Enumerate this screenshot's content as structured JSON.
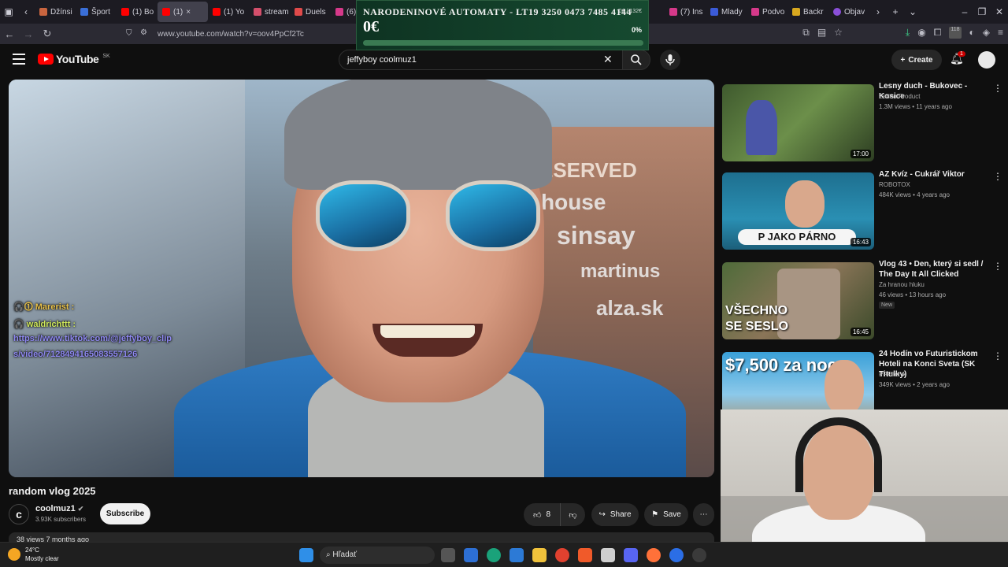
{
  "browser": {
    "tabs": [
      {
        "label": "Džínsi",
        "color": "#c9653f"
      },
      {
        "label": "Šport",
        "color": "#3a6fd8"
      },
      {
        "label": "(1) Bo",
        "color": "#ff0000"
      },
      {
        "label": "(1)",
        "color": "#ff0000"
      },
      {
        "label": "(1) Yo",
        "color": "#ff0000"
      },
      {
        "label": "stream",
        "color": "#d44f6b"
      },
      {
        "label": "Duels",
        "color": "#e04a4a"
      },
      {
        "label": "(6)",
        "color": "#d6398a"
      },
      {
        "label": "(7) Ins",
        "color": "#d6398a"
      },
      {
        "label": "Mlady",
        "color": "#3b5bd8"
      },
      {
        "label": "Podvo",
        "color": "#d6398a"
      },
      {
        "label": "Backr",
        "color": "#d8a81f"
      },
      {
        "label": "Objav",
        "color": "#8a4fd8"
      }
    ],
    "url": "www.youtube.com/watch?v=oov4PpCf2Tc",
    "download_badge": "118"
  },
  "donation": {
    "title": "NARODENINOVÉ AUTOMATY - LT19 3250 0473 7485 4144",
    "goal": "0€ / 132€",
    "amount": "0€",
    "percent": "0%",
    "progress": 0
  },
  "youtube": {
    "logo": "YouTube",
    "country": "SK",
    "search_value": "jeffyboy coolmuz1",
    "create_label": "Create",
    "notif_count": "1"
  },
  "video": {
    "title": "random vlog 2025",
    "chat": {
      "user1": "Marerist :",
      "user2": "waldrichttt :",
      "message_line1": "https://www.tiktok.com/@jeffyboy_clip",
      "message_line2": "s/video/7128494165083557126"
    },
    "signs": [
      "ESERVED",
      "house",
      "sinsay",
      "martinus",
      "alza.sk"
    ],
    "channel": "coolmuz1",
    "subscribers": "3.93K subscribers",
    "subscribe_label": "Subscribe",
    "likes": "8",
    "share_label": "Share",
    "save_label": "Save",
    "description_snippet": "38 views  7 months ago"
  },
  "recommendations": [
    {
      "title": "Lesny duch - Bukovec - Kosice",
      "channel": "Zeden Product",
      "meta": "1.3M views • 11 years ago",
      "duration": "17:00",
      "verified": false,
      "is_new": false
    },
    {
      "title": "AZ Kvíz - Cukrář Viktor",
      "channel": "ROBOTOX",
      "meta": "484K views • 4 years ago",
      "duration": "16:43",
      "verified": false,
      "is_new": false,
      "thumb_text": "P JAKO PÁRNO"
    },
    {
      "title": "Vlog 43 • Den, který si sedl / The Day It All Clicked",
      "channel": "Za hranou hluku",
      "meta": "46 views • 13 hours ago",
      "duration": "16:45",
      "verified": false,
      "is_new": true,
      "new_label": "New",
      "thumb_text": "VŠECHNO SE SESLO"
    },
    {
      "title": "24 Hodín vo Futuristickom Hoteli na Konci Sveta (SK Titulky)",
      "channel": "PPPiter",
      "meta": "349K views • 2 years ago",
      "duration": "",
      "verified": true,
      "is_new": false,
      "thumb_text": "$7,500 za noc"
    }
  ],
  "taskbar": {
    "temperature": "24°C",
    "condition": "Mostly clear",
    "search_placeholder": "Hľadať"
  }
}
